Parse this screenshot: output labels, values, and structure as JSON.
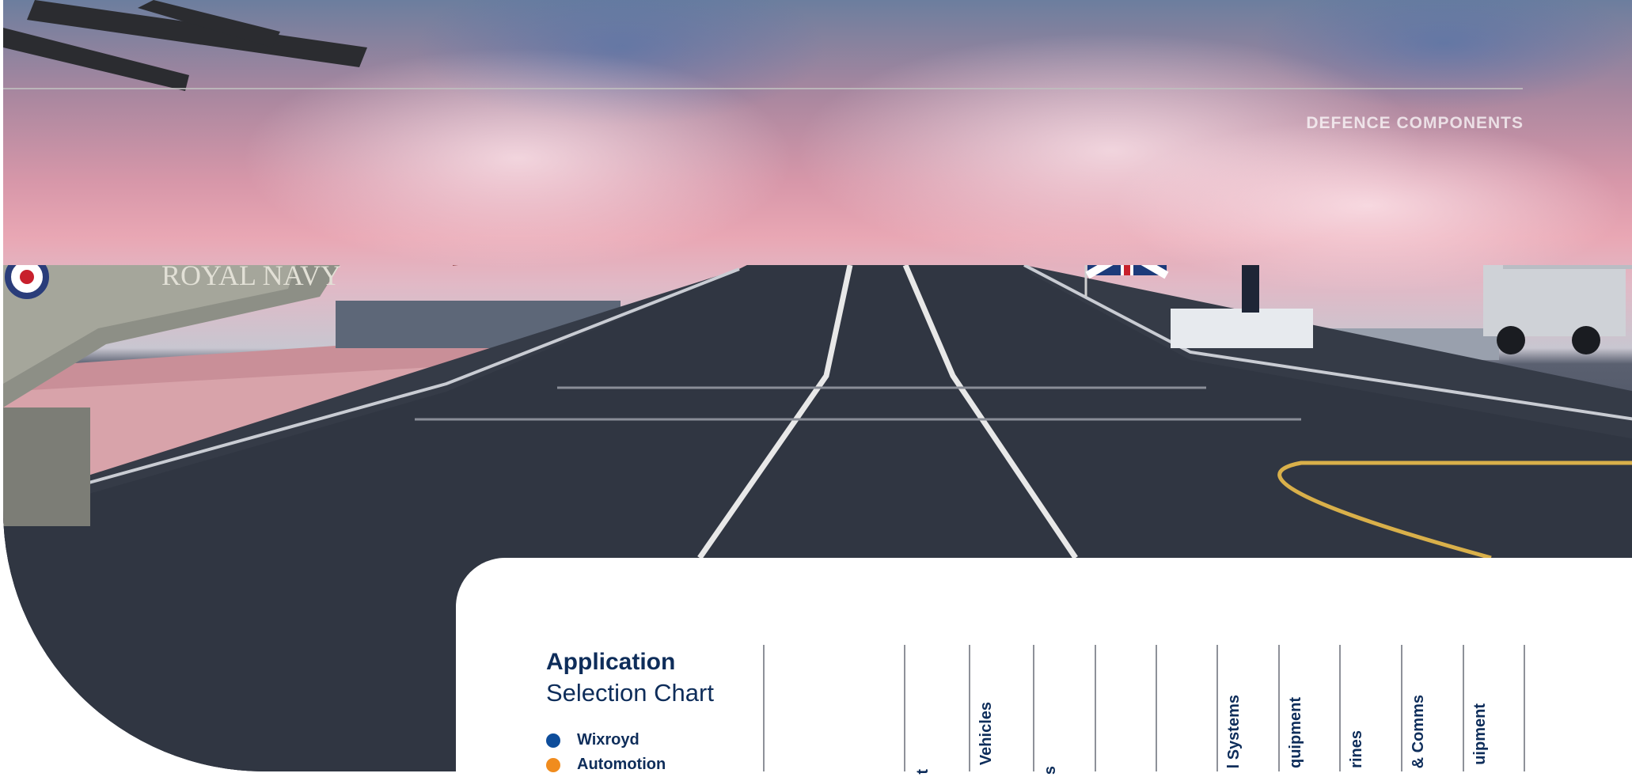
{
  "header": {
    "section_label": "DEFENCE COMPONENTS"
  },
  "hero_image": {
    "helicopter_marking": "ROYAL NAVY"
  },
  "chart": {
    "title": "Application",
    "subtitle": "Selection Chart",
    "legend": [
      {
        "label": "Wixroyd",
        "color": "#0e4d9b"
      },
      {
        "label": "Automotion",
        "color": "#f08c1e"
      }
    ],
    "column_labels": [
      "t",
      "Vehicles",
      "s",
      "",
      "",
      "l Systems",
      "quipment",
      "rines",
      "& Comms",
      "uipment"
    ]
  },
  "colors": {
    "brand_navy": "#0e2d5a",
    "divider": "#8e9199"
  }
}
